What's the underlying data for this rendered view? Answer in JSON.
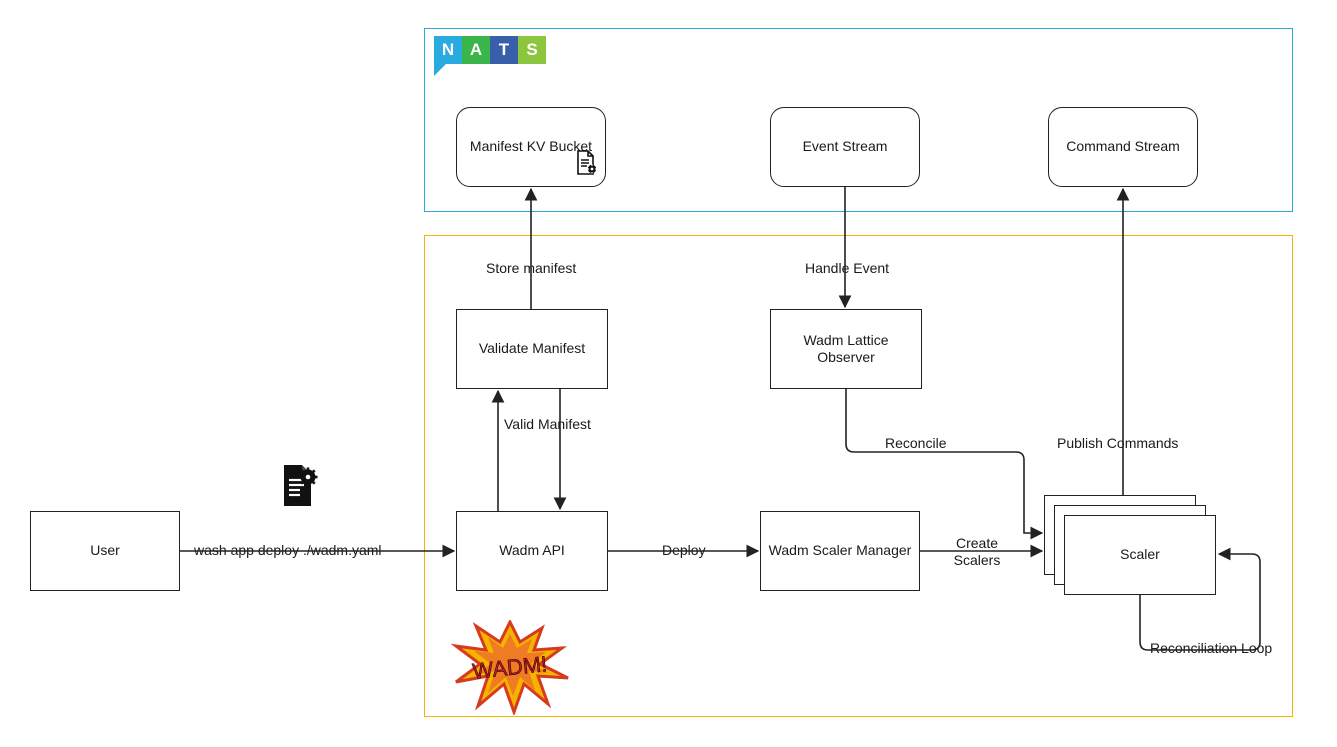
{
  "containers": {
    "nats_label_letters": [
      "N",
      "A",
      "T",
      "S"
    ],
    "nats_colors": [
      "#29abe2",
      "#3ab54a",
      "#395fab",
      "#8cc63f"
    ]
  },
  "nodes": {
    "user": "User",
    "manifest_kv": "Manifest KV Bucket",
    "event_stream": "Event Stream",
    "command_stream": "Command Stream",
    "validate_manifest": "Validate Manifest",
    "wadm_lattice_observer": "Wadm Lattice Observer",
    "wadm_api": "Wadm API",
    "wadm_scaler_manager": "Wadm Scaler Manager",
    "scaler": "Scaler"
  },
  "edges": {
    "wash_deploy": "wash app deploy ./wadm.yaml",
    "store_manifest": "Store manifest",
    "handle_event": "Handle Event",
    "valid_manifest": "Valid Manifest",
    "deploy": "Deploy",
    "reconcile": "Reconcile",
    "create_scalers": "Create Scalers",
    "publish_commands": "Publish Commands",
    "reconciliation_loop": "Reconciliation Loop"
  },
  "badges": {
    "wadm_burst": "WADM!"
  }
}
